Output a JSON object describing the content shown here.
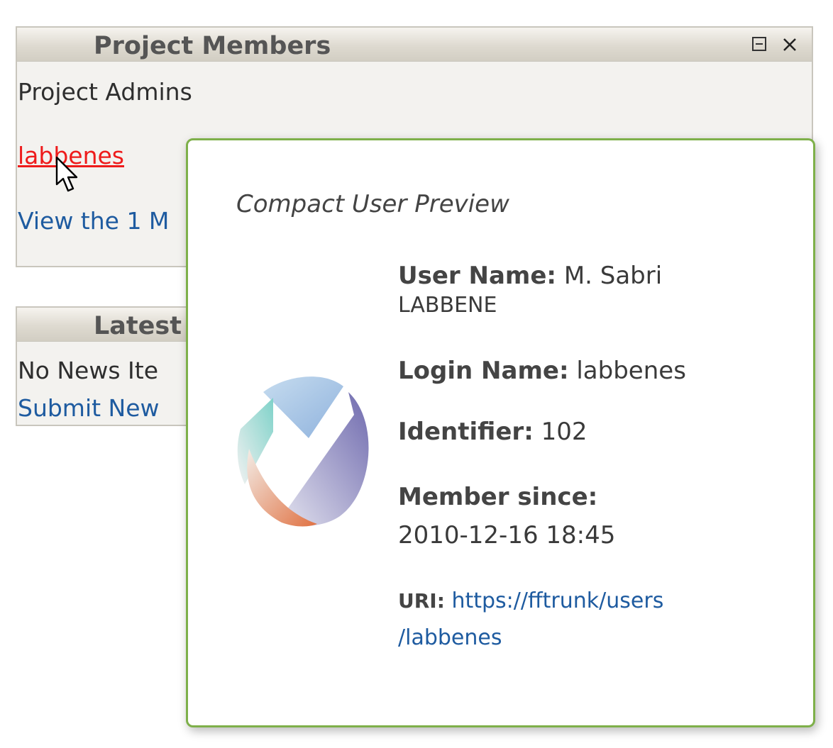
{
  "members_widget": {
    "title": "Project Members",
    "controls": {
      "minimize_icon": "minimize-icon",
      "close_icon": "close-icon"
    },
    "section_label": "Project Admins",
    "admin_user": "labbenes",
    "view_link": "View the 1 M"
  },
  "news_widget": {
    "title": "Latest",
    "empty_text": "No News Ite",
    "submit_link": "Submit New"
  },
  "popup": {
    "title": "Compact User Preview",
    "logo_icon": "fusionforge-logo-icon",
    "user_name_label": "User Name:",
    "user_name_line1": "M. Sabri",
    "user_name_line2": "LABBENE",
    "login_name_label": "Login Name:",
    "login_name_value": "labbenes",
    "identifier_label": "Identifier:",
    "identifier_value": "102",
    "member_since_label": "Member since:",
    "member_since_value": "2010-12-16 18:45",
    "uri_label": "URI:",
    "uri_line1": "https://fftrunk/users",
    "uri_line2": "/labbenes"
  },
  "colors": {
    "popup_border": "#7eb04a",
    "link_blue": "#1e5ba0",
    "link_active_red": "#ee1b1b",
    "widget_border": "#c9c6bd"
  }
}
